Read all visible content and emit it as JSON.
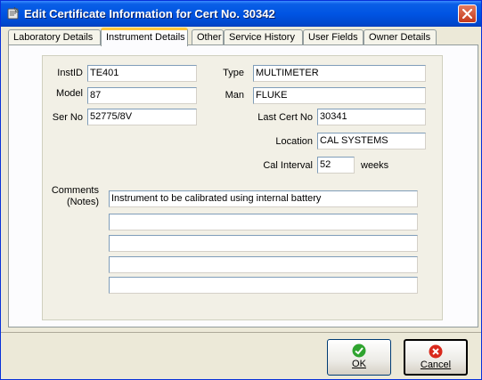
{
  "window": {
    "title": "Edit Certificate Information for Cert No. 30342"
  },
  "tabs": [
    {
      "label": "Laboratory Details",
      "active": false
    },
    {
      "label": "Instrument Details",
      "active": true
    },
    {
      "label": "Other",
      "active": false
    },
    {
      "label": "Service History",
      "active": false
    },
    {
      "label": "User Fields",
      "active": false
    },
    {
      "label": "Owner Details",
      "active": false
    }
  ],
  "instrument": {
    "instid_label": "InstID",
    "instid_value": "TE401",
    "model_label": "Model",
    "model_value": "87",
    "serno_label": "Ser No",
    "serno_value": "52775/8V",
    "type_label": "Type",
    "type_value": "MULTIMETER",
    "man_label": "Man",
    "man_value": "FLUKE",
    "lastcert_label": "Last Cert No",
    "lastcert_value": "30341",
    "location_label": "Location",
    "location_value": "CAL SYSTEMS",
    "calinterval_label": "Cal Interval",
    "calinterval_value": "52",
    "calinterval_unit": "weeks",
    "comments_label": "Comments",
    "comments_sublabel": "(Notes)",
    "comments": [
      "Instrument to be calibrated using internal battery",
      "",
      "",
      "",
      ""
    ]
  },
  "buttons": {
    "ok_label": "OK",
    "cancel_label": "Cancel"
  },
  "colors": {
    "titlebar": "#0054E3",
    "ok_icon": "#2FA42F",
    "cancel_icon": "#D9281B"
  }
}
